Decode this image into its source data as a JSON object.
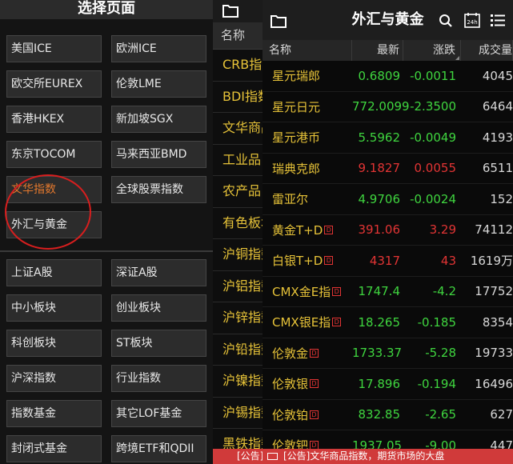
{
  "left": {
    "title": "选择页面",
    "group1": [
      "美国ICE",
      "欧洲ICE",
      "欧交所EUREX",
      "伦敦LME",
      "香港HKEX",
      "新加坡SGX",
      "东京TOCOM",
      "马来西亚BMD",
      "文华指数",
      "全球股票指数",
      "外汇与黄金"
    ],
    "group2": [
      "上证A股",
      "深证A股",
      "中小板块",
      "创业板块",
      "科创板块",
      "ST板块",
      "沪深指数",
      "行业指数",
      "指数基金",
      "其它LOF基金",
      "封闭式基金",
      "跨境ETF和QDII"
    ],
    "active_item": "文华指数",
    "highlight_color": "#e2782e",
    "annotation_color": "#d81e1e"
  },
  "middle": {
    "column_header": "名称",
    "rows": [
      "CRB指数",
      "BDI指数",
      "文华商品",
      "工业品",
      "农产品",
      "有色板块",
      "沪铜指数",
      "沪铝指数",
      "沪锌指数",
      "沪铅指数",
      "沪镍指数",
      "沪锡指数",
      "黑铁指数"
    ],
    "banner": "[公告]"
  },
  "right": {
    "title": "外汇与黄金",
    "headers": {
      "name": "名称",
      "last": "最新",
      "change": "涨跌",
      "volume": "成交量"
    },
    "rows": [
      {
        "name": "星元瑞郎",
        "badge": "",
        "last": "0.6809",
        "change": "-0.0011",
        "volume": "4045",
        "dir": "dn"
      },
      {
        "name": "星元日元",
        "badge": "",
        "last": "772.0099",
        "change": "-2.3500",
        "volume": "6464",
        "dir": "dn"
      },
      {
        "name": "星元港币",
        "badge": "",
        "last": "5.5962",
        "change": "-0.0049",
        "volume": "4193",
        "dir": "dn"
      },
      {
        "name": "瑞典克郎",
        "badge": "",
        "last": "9.1827",
        "change": "0.0055",
        "volume": "6511",
        "dir": "up"
      },
      {
        "name": "雷亚尔",
        "badge": "",
        "last": "4.9706",
        "change": "-0.0024",
        "volume": "152",
        "dir": "dn"
      },
      {
        "name": "黄金T+D",
        "badge": "D",
        "last": "391.06",
        "change": "3.29",
        "volume": "74112",
        "dir": "up"
      },
      {
        "name": "白银T+D",
        "badge": "D",
        "last": "4317",
        "change": "43",
        "volume": "1619万",
        "dir": "up"
      },
      {
        "name": "CMX金E指",
        "badge": "D",
        "last": "1747.4",
        "change": "-4.2",
        "volume": "17752",
        "dir": "dn"
      },
      {
        "name": "CMX银E指",
        "badge": "D",
        "last": "18.265",
        "change": "-0.185",
        "volume": "8354",
        "dir": "dn"
      },
      {
        "name": "伦敦金",
        "badge": "D",
        "last": "1733.37",
        "change": "-5.28",
        "volume": "19733",
        "dir": "dn"
      },
      {
        "name": "伦敦银",
        "badge": "D",
        "last": "17.896",
        "change": "-0.194",
        "volume": "16496",
        "dir": "dn"
      },
      {
        "name": "伦敦铂",
        "badge": "D",
        "last": "832.85",
        "change": "-2.65",
        "volume": "627",
        "dir": "dn"
      },
      {
        "name": "伦敦钯",
        "badge": "D",
        "last": "1937.05",
        "change": "-9.00",
        "volume": "447",
        "dir": "dn"
      }
    ],
    "banner": "[公告]文华商品指数，期货市场的大盘",
    "up_color": "#e23434",
    "down_color": "#3fd53f",
    "name_color": "#e6c238"
  }
}
